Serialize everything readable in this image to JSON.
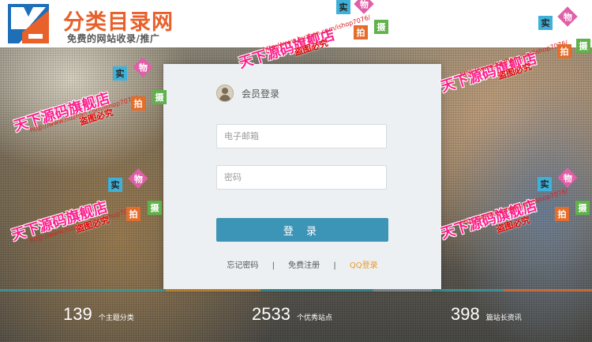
{
  "brand": {
    "title": "分类目录网",
    "subtitle": "免费的网站收录/推广",
    "colors": {
      "orange": "#e8602a",
      "blue": "#1d6fb8"
    }
  },
  "login": {
    "title": "会员登录",
    "email_placeholder": "电子邮箱",
    "password_placeholder": "密码",
    "submit_label": "登 录",
    "forgot_label": "忘记密码",
    "register_label": "免费注册",
    "qq_label": "QQ登录",
    "separator": "|",
    "accent_color": "#3c94b6"
  },
  "stats": [
    {
      "number": "139",
      "label": "个主题分类"
    },
    {
      "number": "2533",
      "label": "个优秀站点"
    },
    {
      "number": "398",
      "label": "篇站长资讯"
    }
  ],
  "watermarks": {
    "shop": "天下源码旗舰店",
    "url": "http://www.huzhan.com/ishop7076/",
    "warning": "盗图必究",
    "tags": [
      "实",
      "物",
      "拍",
      "摄"
    ]
  }
}
